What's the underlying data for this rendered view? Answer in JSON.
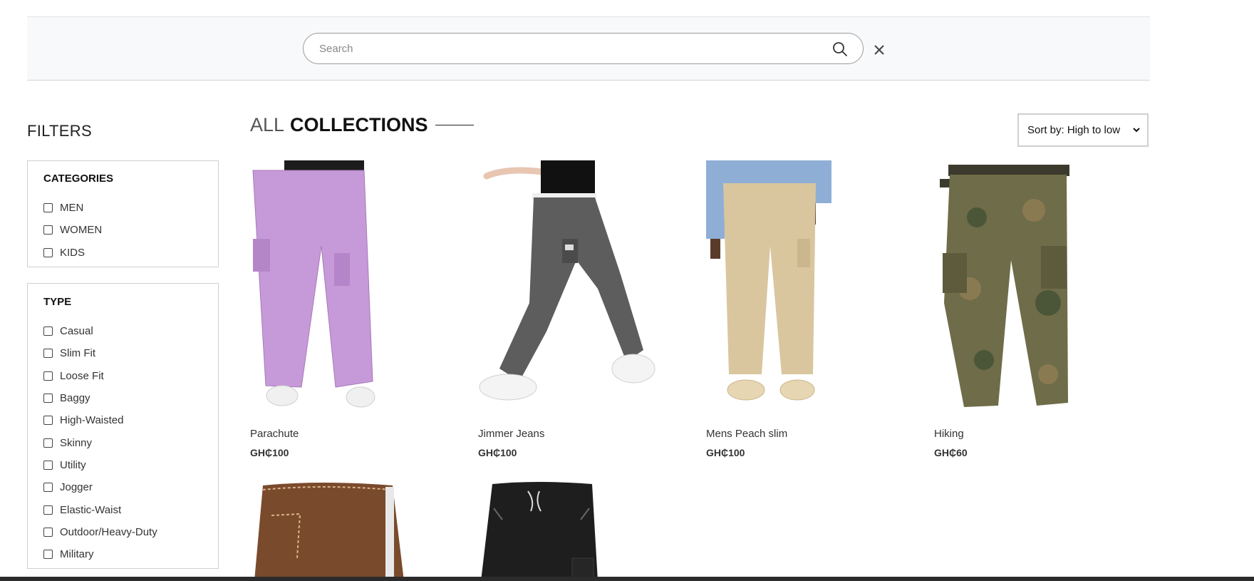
{
  "search": {
    "placeholder": "Search"
  },
  "filters": {
    "title": "FILTERS",
    "categories": {
      "heading": "CATEGORIES",
      "items": [
        "MEN",
        "WOMEN",
        "KIDS"
      ]
    },
    "type": {
      "heading": "TYPE",
      "items": [
        "Casual",
        "Slim Fit",
        "Loose Fit",
        "Baggy",
        "High-Waisted",
        "Skinny",
        "Utility",
        "Jogger",
        "Elastic-Waist",
        "Outdoor/Heavy-Duty",
        "Military"
      ]
    }
  },
  "collections": {
    "title_light": "ALL",
    "title_bold": "COLLECTIONS"
  },
  "sort": {
    "selected": "Sort by: High to low"
  },
  "products": [
    {
      "name": "Parachute",
      "price": "GH₵100",
      "color": "#c58fd6"
    },
    {
      "name": "Jimmer Jeans",
      "price": "GH₵100",
      "color": "#5c5c5c"
    },
    {
      "name": "Mens Peach slim",
      "price": "GH₵100",
      "color": "#d6c39b"
    },
    {
      "name": "Hiking",
      "price": "GH₵60",
      "color": "#6b6a48"
    },
    {
      "name": "",
      "price": "",
      "color": "#7a4a2c"
    },
    {
      "name": "",
      "price": "",
      "color": "#1e1e1e"
    }
  ]
}
